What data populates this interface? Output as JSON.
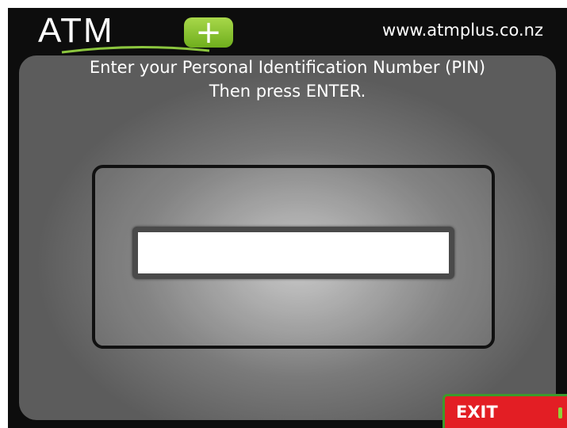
{
  "header": {
    "logo_text": "ATM",
    "logo_plus": "+",
    "website": "www.atmplus.co.nz"
  },
  "prompt": {
    "line1": "Enter your Personal Identification Number (PIN)",
    "line2": "Then press ENTER."
  },
  "pin_input": {
    "value": "",
    "placeholder": ""
  },
  "exit_button": {
    "label": "EXIT"
  },
  "colors": {
    "background": "#0d0d0d",
    "brand_green": "#8cc63f",
    "exit_red": "#e31e24",
    "exit_border_green": "#3c9a2c"
  }
}
